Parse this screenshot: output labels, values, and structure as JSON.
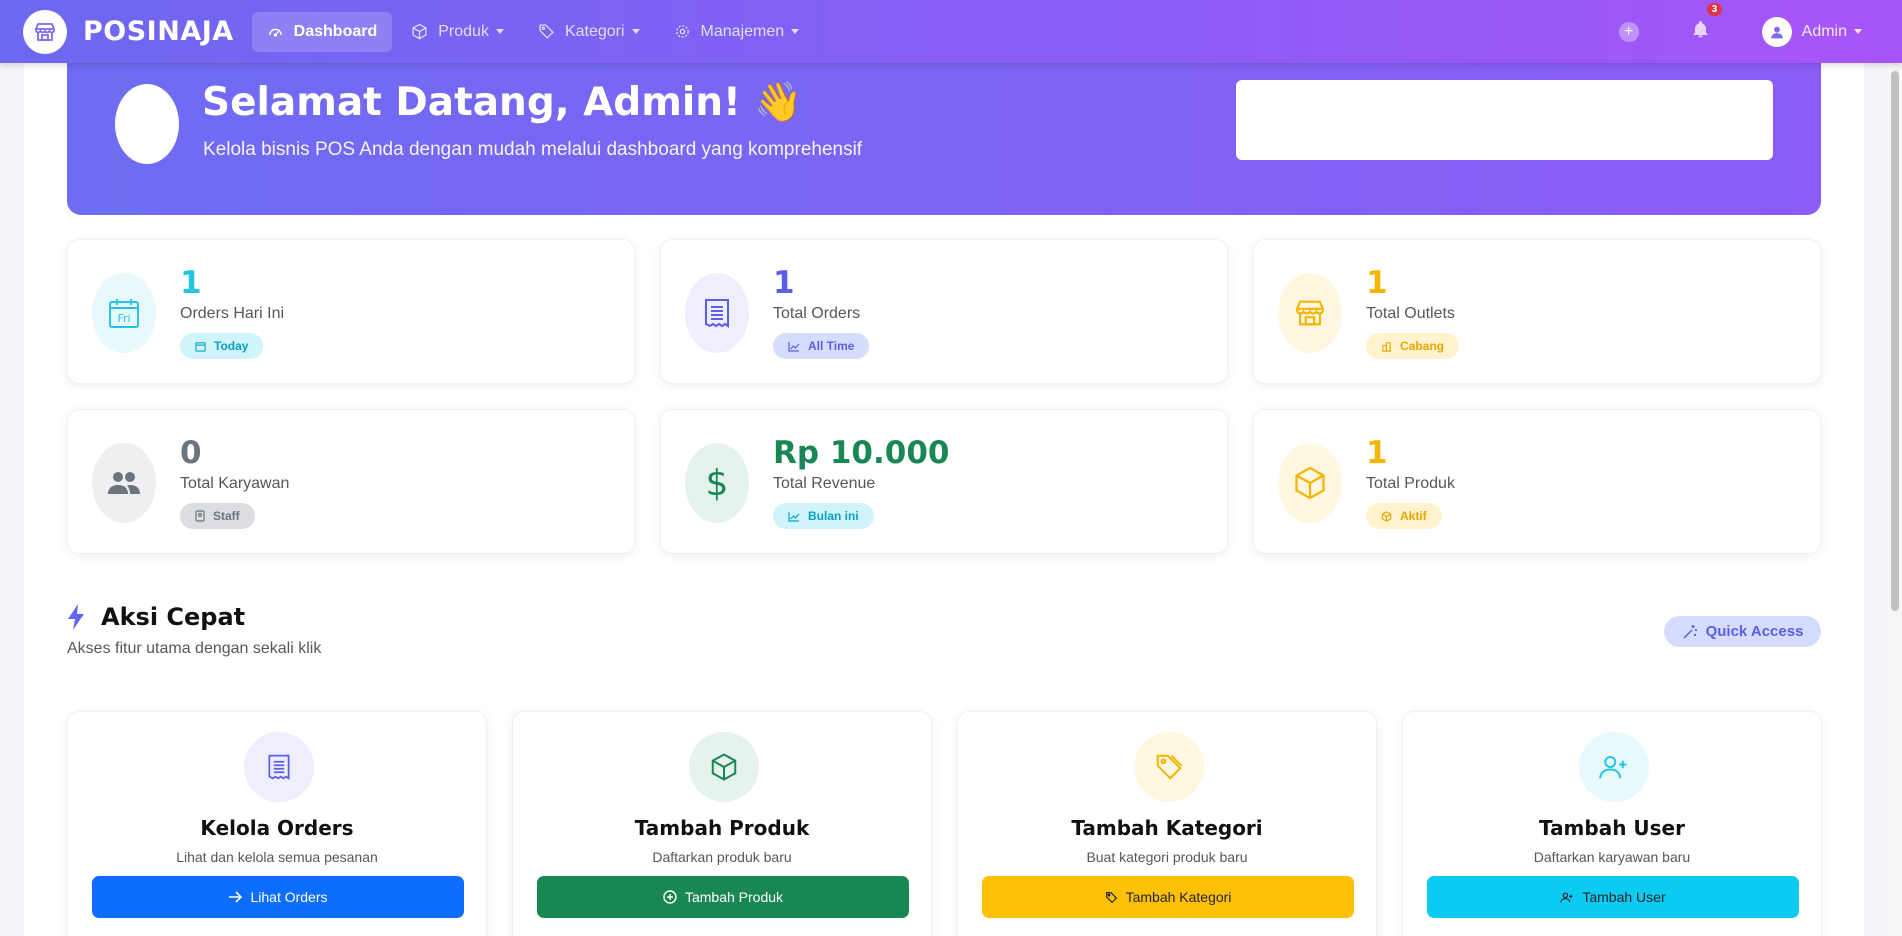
{
  "navbar": {
    "brand": "POSINAJA",
    "items": [
      {
        "label": "Dashboard",
        "icon": "speedometer-icon"
      },
      {
        "label": "Produk",
        "icon": "box-icon"
      },
      {
        "label": "Kategori",
        "icon": "tag-icon"
      },
      {
        "label": "Manajemen",
        "icon": "gear-icon"
      }
    ],
    "notification_count": "3",
    "user": "Admin"
  },
  "hero": {
    "title": "Selamat Datang, Admin! 👋",
    "subtitle": "Kelola bisnis POS Anda dengan mudah melalui dashboard yang komprehensif"
  },
  "stats": [
    {
      "value": "1",
      "label": "Orders Hari Ini",
      "badge": "Today",
      "icon_text": "Fri",
      "color": "#22c5e6"
    },
    {
      "value": "1",
      "label": "Total Orders",
      "badge": "All Time",
      "color": "#5b5ee8"
    },
    {
      "value": "1",
      "label": "Total Outlets",
      "badge": "Cabang",
      "color": "#f5b400"
    },
    {
      "value": "0",
      "label": "Total Karyawan",
      "badge": "Staff",
      "color": "#6c757d"
    },
    {
      "value": "Rp 10.000",
      "label": "Total Revenue",
      "badge": "Bulan ini",
      "color": "#198754"
    },
    {
      "value": "1",
      "label": "Total Produk",
      "badge": "Aktif",
      "color": "#f5b400"
    }
  ],
  "quick": {
    "title": "Aksi Cepat",
    "subtitle": "Akses fitur utama dengan sekali klik",
    "button": "Quick Access"
  },
  "actions": [
    {
      "title": "Kelola Orders",
      "subtitle": "Lihat dan kelola semua pesanan",
      "button": "Lihat Orders",
      "color": "#0d6efd"
    },
    {
      "title": "Tambah Produk",
      "subtitle": "Daftarkan produk baru",
      "button": "Tambah Produk",
      "color": "#198754"
    },
    {
      "title": "Tambah Kategori",
      "subtitle": "Buat kategori produk baru",
      "button": "Tambah Kategori",
      "color": "#ffc107"
    },
    {
      "title": "Tambah User",
      "subtitle": "Daftarkan karyawan baru",
      "button": "Tambah User",
      "color": "#0dcaf0"
    }
  ]
}
